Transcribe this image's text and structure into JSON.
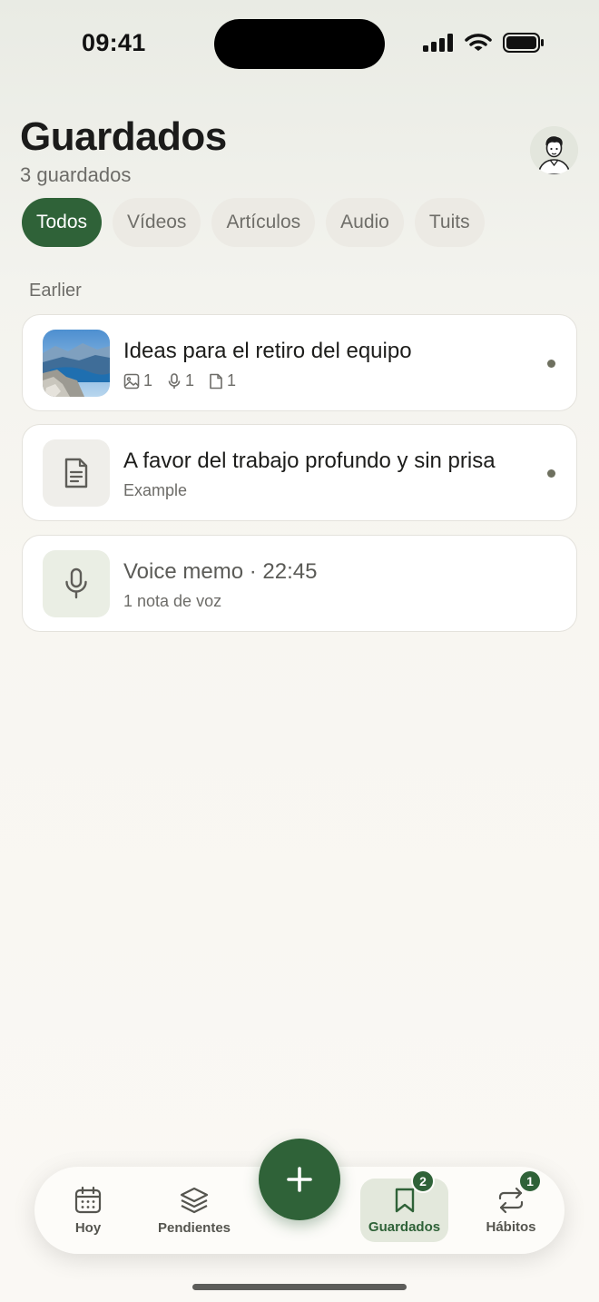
{
  "status_bar": {
    "time": "09:41"
  },
  "header": {
    "title": "Guardados",
    "subtitle": "3 guardados",
    "avatar_icon": "user-avatar"
  },
  "filters": [
    {
      "label": "Todos",
      "active": true
    },
    {
      "label": "Vídeos",
      "active": false
    },
    {
      "label": "Artículos",
      "active": false
    },
    {
      "label": "Audio",
      "active": false
    },
    {
      "label": "Tuits",
      "active": false
    }
  ],
  "section": {
    "label": "Earlier"
  },
  "items": [
    {
      "title": "Ideas para el retiro del equipo",
      "thumbnail": "landscape-photo",
      "meta": {
        "images": "1",
        "voice": "1",
        "docs": "1"
      },
      "unread": true
    },
    {
      "title": "A favor del trabajo profundo y sin prisa",
      "thumbnail": "document-icon",
      "subtitle": "Example",
      "unread": true
    },
    {
      "title": "Voice memo · 22:45",
      "thumbnail": "microphone-icon",
      "subtitle": "1 nota de voz",
      "unread": false
    }
  ],
  "tabbar": {
    "tabs": [
      {
        "label": "Hoy",
        "icon": "calendar-icon"
      },
      {
        "label": "Pendientes",
        "icon": "layers-icon"
      },
      {
        "label": "Guardados",
        "icon": "bookmark-icon",
        "badge": "2",
        "active": true
      },
      {
        "label": "Hábitos",
        "icon": "repeat-icon",
        "badge": "1"
      }
    ],
    "fab_icon": "plus-icon"
  },
  "colors": {
    "accent": "#2f6238",
    "chip_bg": "#eceae4",
    "active_tab_bg": "#e3e8dc"
  }
}
